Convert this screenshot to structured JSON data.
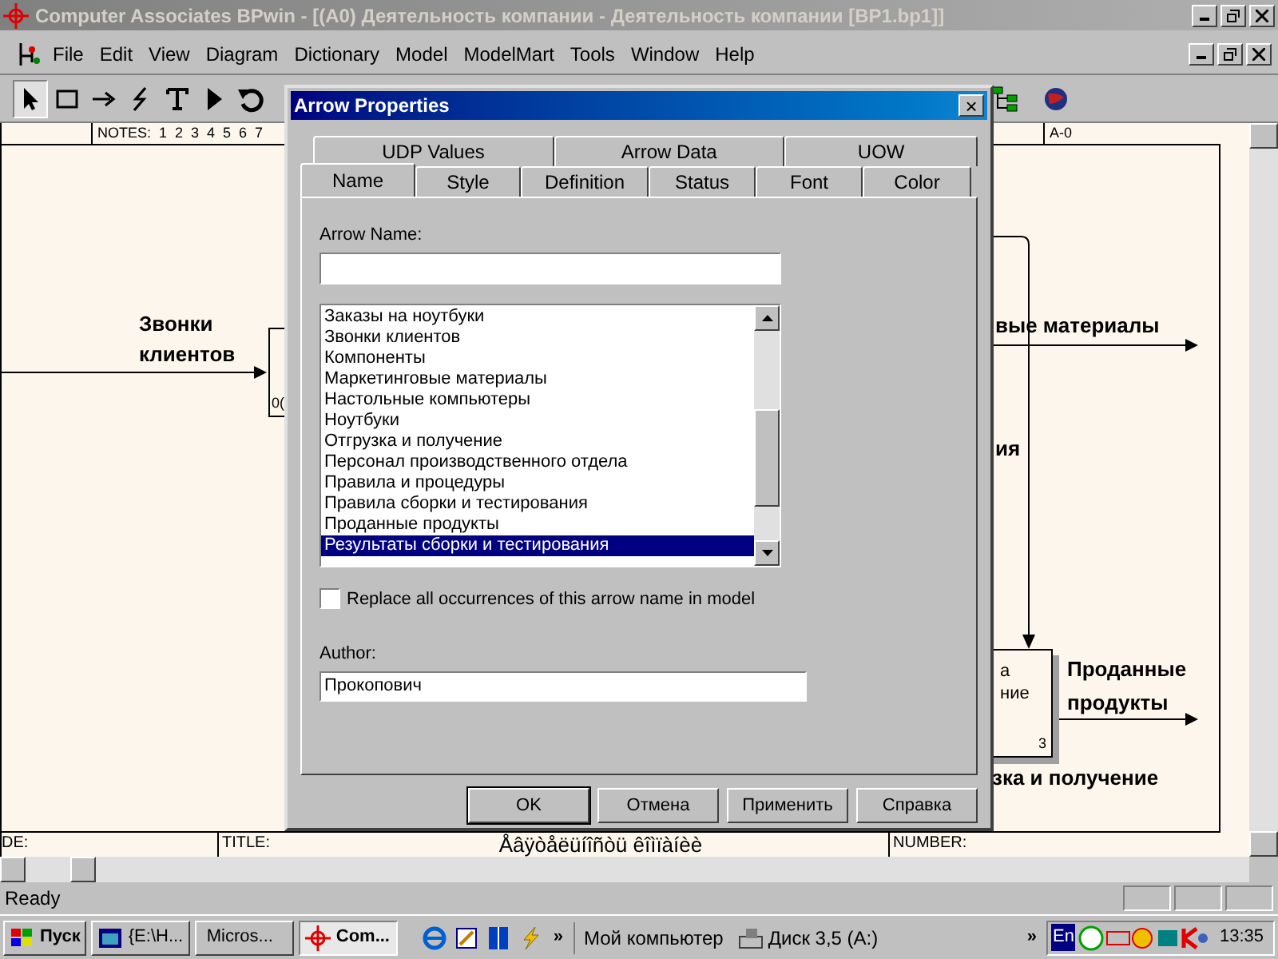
{
  "window": {
    "title": "Computer Associates BPwin - [(A0) Деятельность компании - Деятельность компании  [BP1.bp1]]"
  },
  "menu": [
    "File",
    "Edit",
    "View",
    "Diagram",
    "Dictionary",
    "Model",
    "ModelMart",
    "Tools",
    "Window",
    "Help"
  ],
  "toolbar": [
    {
      "kind": "pointer",
      "selected": true
    },
    {
      "kind": "box",
      "selected": false
    },
    {
      "kind": "arrow",
      "selected": false
    },
    {
      "kind": "squiggle",
      "selected": false
    },
    {
      "kind": "text",
      "selected": false
    },
    {
      "kind": "play",
      "selected": false
    },
    {
      "kind": "undo",
      "selected": false
    }
  ],
  "diagram": {
    "header": {
      "notes": "NOTES:  1  2  3  4  5  6  7",
      "node": "A-0"
    },
    "labels": [
      {
        "text": "Звонки\nклиентов"
      },
      {
        "text": "вые материалы"
      },
      {
        "text": "ия"
      },
      {
        "text": "Проданные\nпродукты"
      },
      {
        "text": "зка и получение"
      }
    ],
    "left_box": {
      "text": "0("
    },
    "right_box": {
      "line_1": "а",
      "line_2": "ние",
      "number": "3"
    },
    "footer": {
      "node": "DE:",
      "title_label": "TITLE:",
      "title": "Åâÿòåëüíîñòü êîìïàíèè",
      "number": "NUMBER:"
    }
  },
  "dialog": {
    "title": "Arrow Properties",
    "close": "×",
    "tab_rows": [
      [
        {
          "label": "UDP Values",
          "selected": false
        },
        {
          "label": "Arrow Data",
          "selected": false
        },
        {
          "label": "UOW",
          "selected": false
        }
      ],
      [
        {
          "label": "Name",
          "selected": true
        },
        {
          "label": "Style",
          "selected": false
        },
        {
          "label": "Definition",
          "selected": false
        },
        {
          "label": "Status",
          "selected": false
        },
        {
          "label": "Font",
          "selected": false
        },
        {
          "label": "Color",
          "selected": false
        }
      ]
    ],
    "name_label": "Arrow Name:",
    "names": [
      {
        "label": "Заказы на ноутбуки",
        "selected": false
      },
      {
        "label": "Звонки клиентов",
        "selected": false
      },
      {
        "label": "Компоненты",
        "selected": false
      },
      {
        "label": "Маркетинговые материалы",
        "selected": false
      },
      {
        "label": "Настольные компьютеры",
        "selected": false
      },
      {
        "label": "Ноутбуки",
        "selected": false
      },
      {
        "label": "Отгрузка и получение",
        "selected": false
      },
      {
        "label": "Персонал производственного отдела",
        "selected": false
      },
      {
        "label": "Правила и процедуры",
        "selected": false
      },
      {
        "label": "Правила сборки и тестирования",
        "selected": false
      },
      {
        "label": "Проданные продукты",
        "selected": false
      },
      {
        "label": "Результаты сборки и тестирования",
        "selected": true
      }
    ],
    "replace": {
      "label": "Replace all occurrences of this arrow name in model",
      "checked": false
    },
    "author_label": "Author:",
    "author_value": "Прокопович",
    "buttons": [
      {
        "label": "OK",
        "default": true
      },
      {
        "label": "Отмена",
        "default": false
      },
      {
        "label": "Применить",
        "default": false
      },
      {
        "label": "Справка",
        "default": false
      }
    ]
  },
  "status_bar": {
    "text": "Ready"
  },
  "taskbar": {
    "start": "Пуск",
    "tasks": [
      {
        "label": "{E:\\H...",
        "kind": "folder",
        "selected": false
      },
      {
        "label": "Micros...",
        "kind": "word",
        "selected": false
      },
      {
        "label": "Com...",
        "kind": "bpwin",
        "selected": true
      }
    ],
    "more_1": "»",
    "links": [
      {
        "label": "Мой компьютер",
        "kind": "none"
      },
      {
        "label": "Диск 3,5 (A:)",
        "kind": "drive"
      }
    ],
    "more_2": "»",
    "language": "En",
    "clock": "13:35"
  }
}
